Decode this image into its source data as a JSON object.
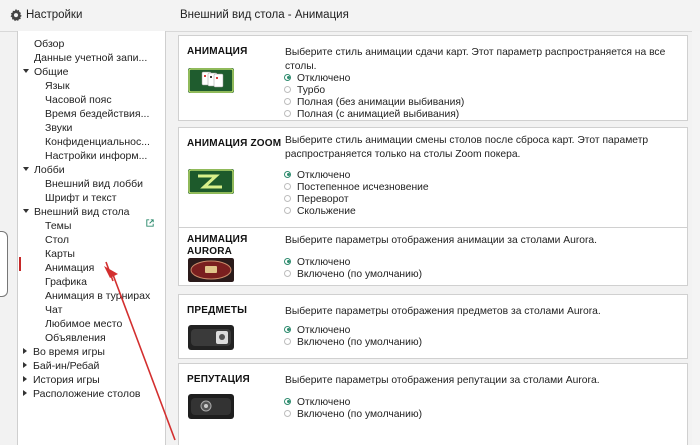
{
  "window": {
    "settings_title": "Настройки",
    "page_header": "Внешний вид стола - Анимация"
  },
  "sidebar": {
    "overview": "Обзор",
    "account": "Данные учетной запи...",
    "general": "Общие",
    "general_items": [
      "Язык",
      "Часовой пояс",
      "Время бездействия...",
      "Звуки",
      "Конфиденциальнос...",
      "Настройки информ..."
    ],
    "lobby": "Лобби",
    "lobby_items": [
      "Внешний вид лобби",
      "Шрифт и текст"
    ],
    "table_look": "Внешний вид стола",
    "table_items": [
      "Темы",
      "Стол",
      "Карты",
      "Анимация",
      "Графика",
      "Анимация в турнирах",
      "Чат",
      "Любимое место",
      "Объявления"
    ],
    "in_game": "Во время игры",
    "buyin": "Бай-ин/Ребай",
    "history": "История игры",
    "tables_layout": "Расположение столов",
    "active_item": "Анимация"
  },
  "sections": [
    {
      "title": "АНИМАЦИЯ",
      "description": "Выберите стиль анимации сдачи карт. Этот параметр распространяется на все столы.",
      "options": [
        "Отключено",
        "Турбо",
        "Полная (без анимации выбивания)",
        "Полная (с анимацией выбивания)"
      ],
      "selected": "Отключено"
    },
    {
      "title": "АНИМАЦИЯ ZOOM",
      "description": "Выберите стиль анимации смены столов после сброса карт. Этот параметр распространяется только на столы Zoom покера.",
      "options": [
        "Отключено",
        "Постепенное исчезновение",
        "Переворот",
        "Скольжение"
      ],
      "selected": "Отключено"
    },
    {
      "title": "АНИМАЦИЯ AURORA",
      "title_line1": "АНИМАЦИЯ",
      "title_line2": "AURORA",
      "description": "Выберите параметры отображения анимации за столами Aurora.",
      "options": [
        "Отключено",
        "Включено (по умолчанию)"
      ],
      "selected": "Отключено"
    },
    {
      "title": "ПРЕДМЕТЫ",
      "description": "Выберите параметры отображения предметов за столами Aurora.",
      "options": [
        "Отключено",
        "Включено (по умолчанию)"
      ],
      "selected": "Отключено"
    },
    {
      "title": "РЕПУТАЦИЯ",
      "description": "Выберите параметры отображения репутации за столами Aurora.",
      "options": [
        "Отключено",
        "Включено (по умолчанию)"
      ],
      "selected": "Отключено"
    }
  ],
  "colors": {
    "accent_green": "#2e8b6e",
    "active_marker": "#c62828",
    "annotation_arrow": "#d32f2f"
  },
  "icons": {
    "settings": "gear-icon",
    "external_link": "external-link-icon"
  }
}
